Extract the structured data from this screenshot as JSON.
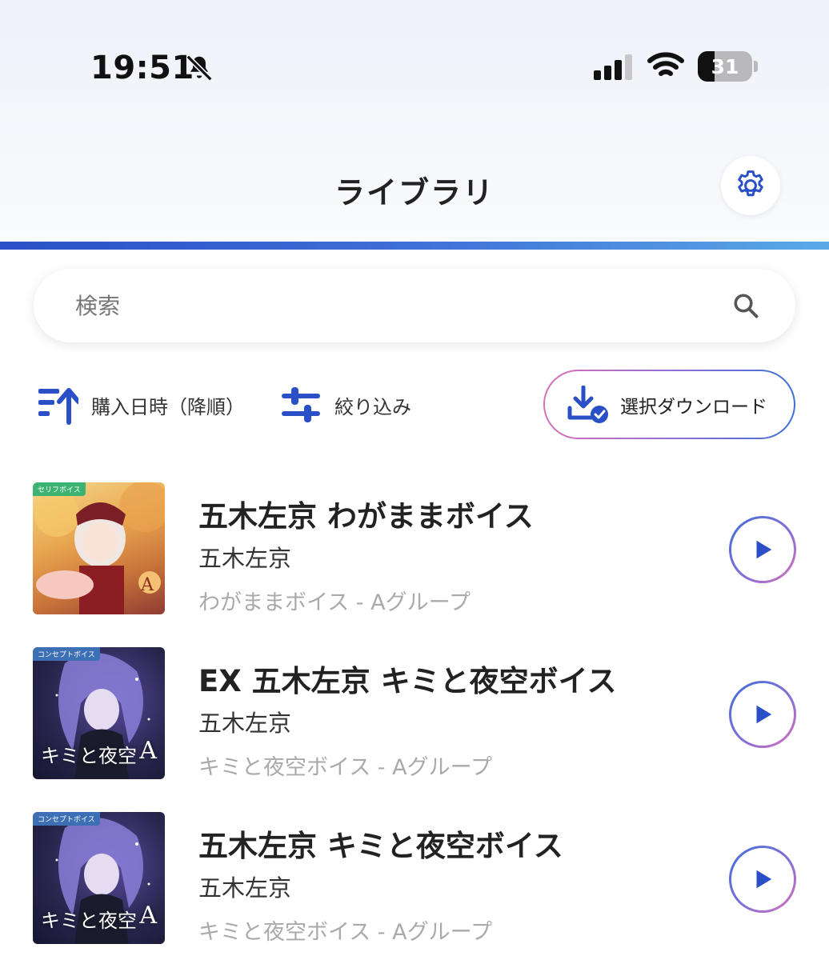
{
  "status_bar": {
    "time": "19:51",
    "battery_level": "31",
    "icons": [
      "bell-slash-icon",
      "signal-icon",
      "wifi-icon",
      "battery-icon"
    ]
  },
  "header": {
    "title": "ライブラリ",
    "settings_icon": "gear-icon",
    "accent_line_colors": [
      "#2a4fc7",
      "#5aa9e6"
    ]
  },
  "search": {
    "placeholder": "検索",
    "value": ""
  },
  "toolbar": {
    "sort_label": "購入日時（降順）",
    "filter_label": "絞り込み",
    "download_label": "選択ダウンロード"
  },
  "colors": {
    "accent_blue": "#2a4fc7",
    "accent_pink": "#d970b8",
    "text_primary": "#222222",
    "text_muted": "#aaaaaa"
  },
  "items": [
    {
      "title": "五木左京 わがままボイス",
      "artist": "五木左京",
      "album": "わがままボイス - Aグループ",
      "thumb_badge": "セリフボイス",
      "thumb_text": "",
      "thumb_group": "A"
    },
    {
      "title": "EX 五木左京 キミと夜空ボイス",
      "artist": "五木左京",
      "album": "キミと夜空ボイス - Aグループ",
      "thumb_badge": "コンセプトボイス",
      "thumb_text": "キミと夜空",
      "thumb_group": "A"
    },
    {
      "title": "五木左京 キミと夜空ボイス",
      "artist": "五木左京",
      "album": "キミと夜空ボイス - Aグループ",
      "thumb_badge": "コンセプトボイス",
      "thumb_text": "キミと夜空",
      "thumb_group": "A"
    }
  ]
}
